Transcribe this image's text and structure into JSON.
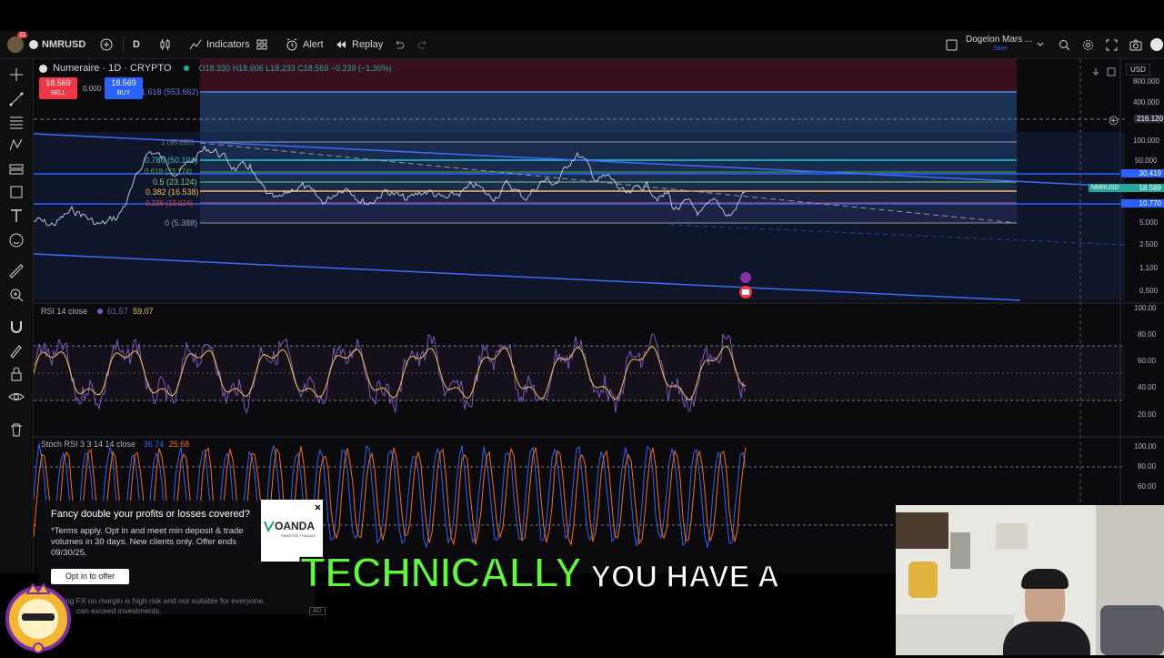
{
  "toolbar": {
    "symbol": "NMRUSD",
    "notifications": "11",
    "interval": "D",
    "indicators": "Indicators",
    "alert": "Alert",
    "replay": "Replay",
    "layout_name": "Dogelon Mars ...",
    "layout_status": "Save"
  },
  "legend": {
    "title": "Numeraire · 1D · CRYPTO",
    "ohlc": "O18.330 H18.606 L18.233 C18.569 −0.239 (−1.30%)",
    "sell_price": "18.569",
    "sell_label": "SELL",
    "spread": "0.000",
    "buy_price": "18.569",
    "buy_label": "BUY"
  },
  "fib_levels": [
    {
      "label": "1.618 (553.662)",
      "color": "#5b7bd6"
    },
    {
      "label": "1 (95.690)",
      "color": "#787b86"
    },
    {
      "label": "0.786 (50.104)",
      "color": "#26c6da"
    },
    {
      "label": "0.618 (33.174)",
      "color": "#4caf50"
    },
    {
      "label": "0.5 (23.124)",
      "color": "#81c784"
    },
    {
      "label": "0.382 (16.538)",
      "color": "#ffb74d"
    },
    {
      "label": "0.236 (10.024)",
      "color": "#f44336"
    },
    {
      "label": "0 (5.388)",
      "color": "#787b86"
    }
  ],
  "price_axis": {
    "currency": "USD",
    "labels": [
      "800.000",
      "400.000",
      "216.120",
      "100.000",
      "50.000",
      "30.419",
      "18.569",
      "10.770",
      "5.000",
      "2.500",
      "1.100",
      "0.500"
    ],
    "current_symbol": "NMRUSD"
  },
  "rsi": {
    "title": "RSI 14 close",
    "value1": "61.57",
    "value2": "59.07",
    "axis": [
      "100.00",
      "80.00",
      "60.00",
      "40.00",
      "20.00"
    ]
  },
  "stoch": {
    "title": "Stoch RSI 3 3 14 14 close",
    "value1": "36.74",
    "value2": "25.68",
    "axis": [
      "100.00",
      "80.00",
      "60.00"
    ]
  },
  "ad": {
    "headline": "Fancy double your profits or losses covered?",
    "body": "*Terms apply. Opt in and meet min deposit & trade volumes in 30 days. New clients only. Offer ends 09/30/25.",
    "button": "Opt in to offer",
    "disclaimer_1": "ing FX on margin is high risk and not suitable for everyone.",
    "disclaimer_2": "can exceed investments.",
    "ad_badge": "AD",
    "brand": "OANDA",
    "brand_sub": "SMARTER TRADING"
  },
  "caption": {
    "big": "TECHNICALLY",
    "small": "YOU HAVE A"
  },
  "colors": {
    "accent_blue": "#2962ff",
    "buy_blue": "#2962ff",
    "sell_red": "#f23645",
    "rsi_line": "#7e57c2",
    "rsi_ma": "#f5c34a",
    "stoch_k": "#2962ff",
    "stoch_d": "#ff6d00",
    "caption_green": "#5dfc38"
  }
}
